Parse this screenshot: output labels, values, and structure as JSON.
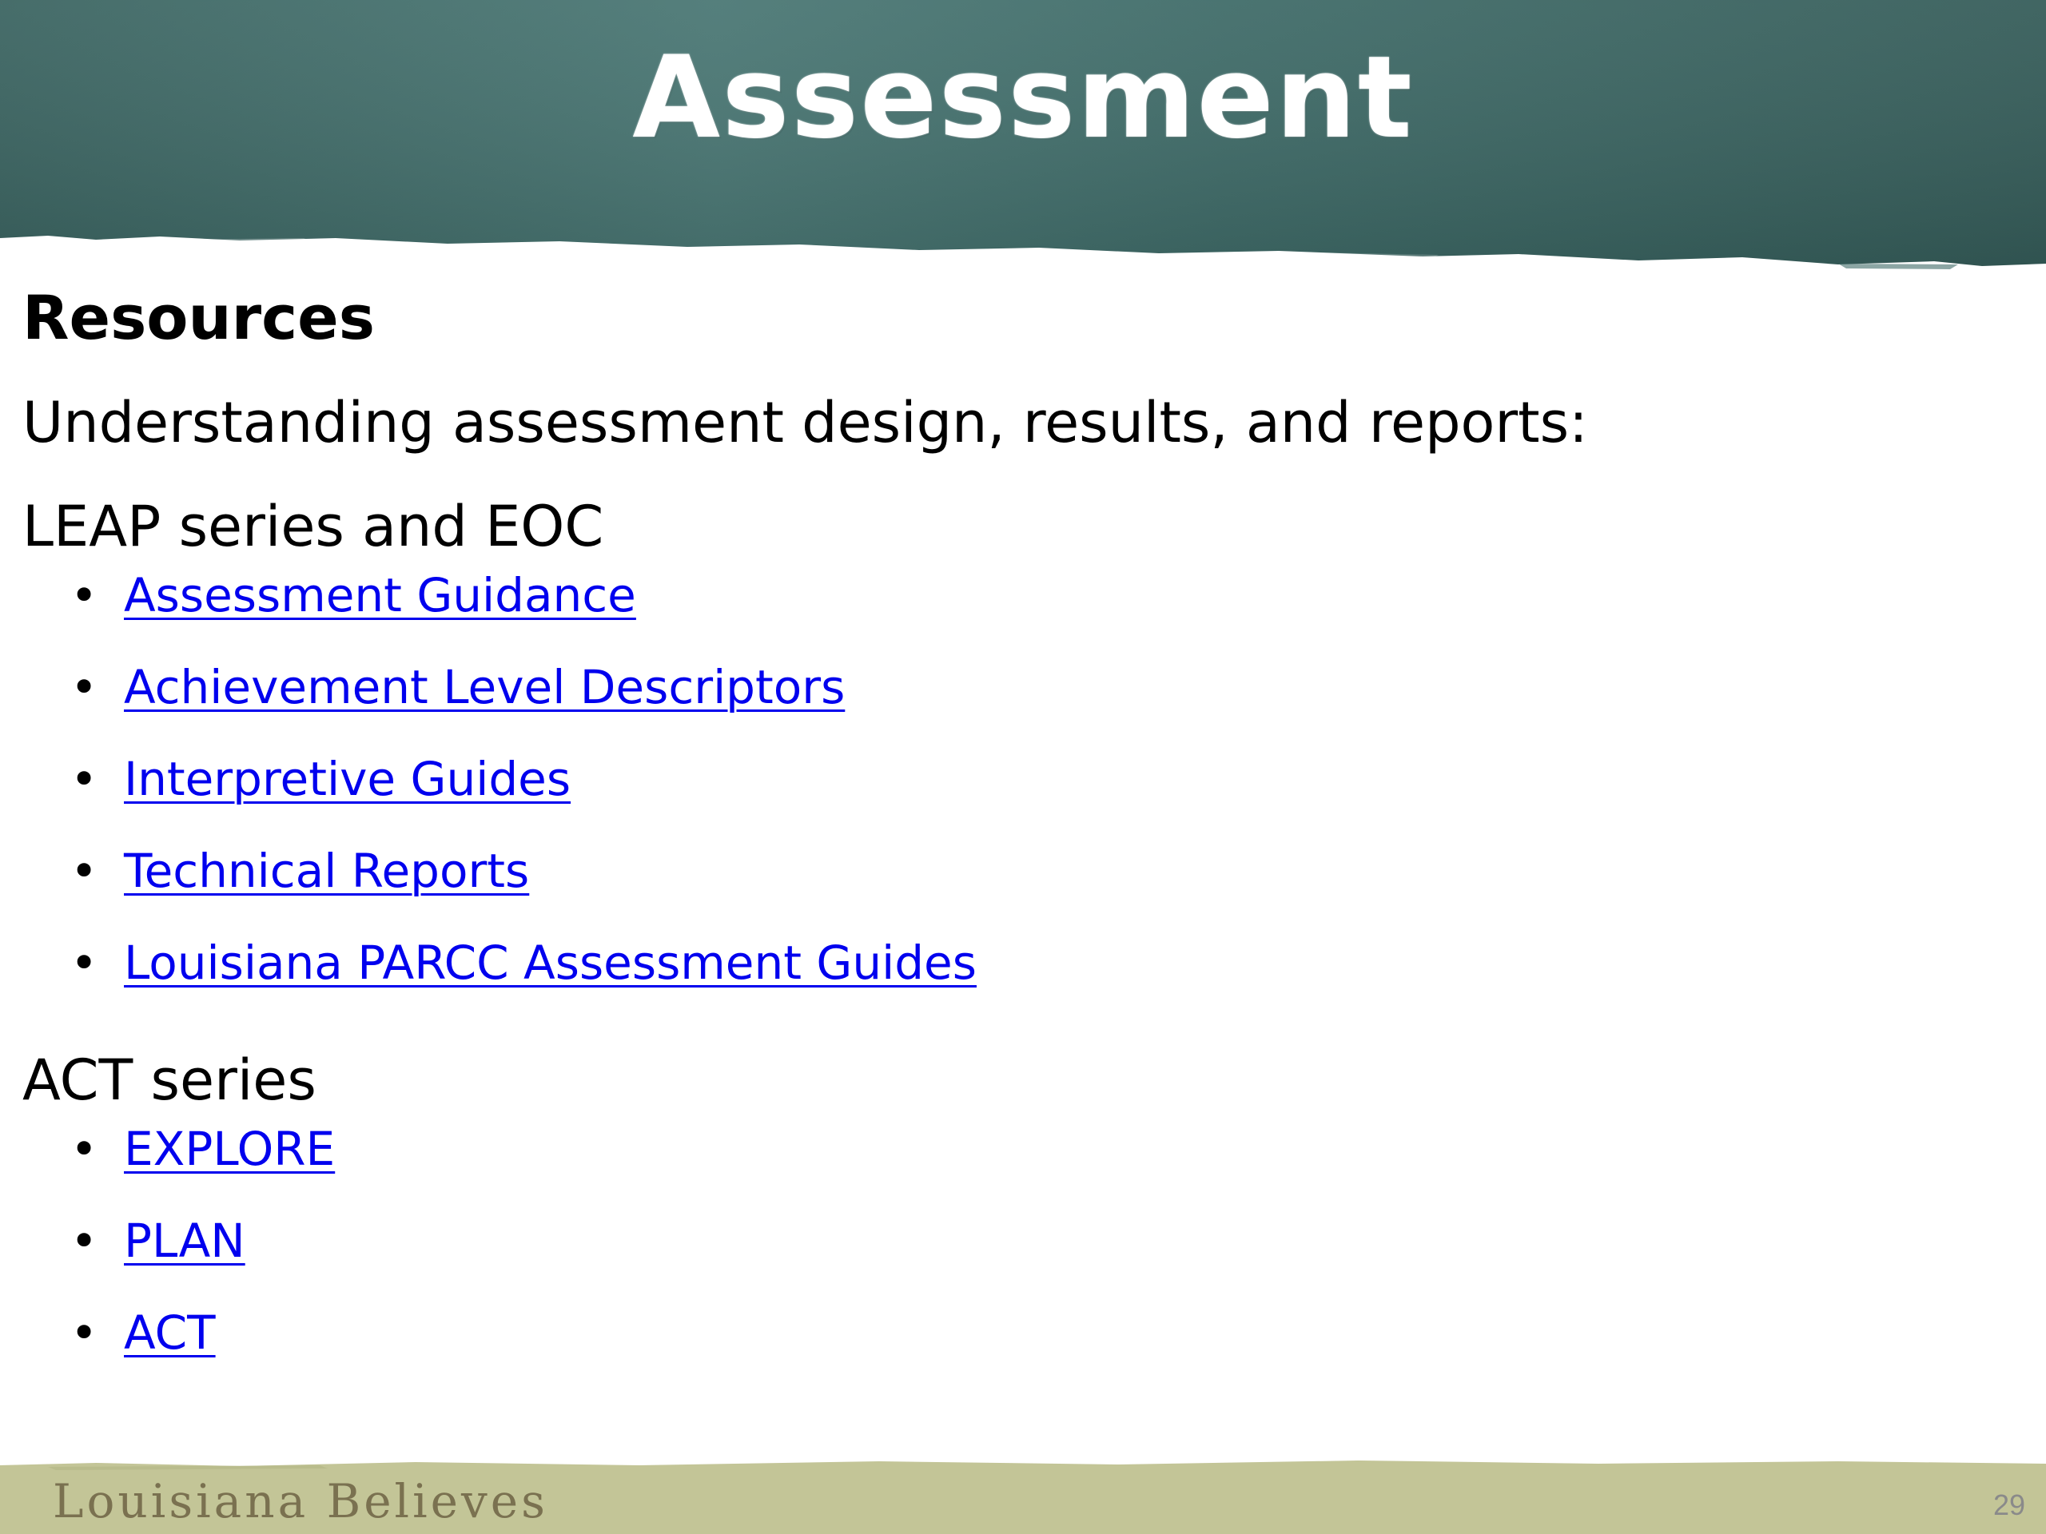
{
  "slide": {
    "title": "Assessment",
    "heading": "Resources",
    "intro": "Understanding assessment design, results, and reports:",
    "sections": [
      {
        "label": "LEAP series and EOC",
        "links": [
          "Assessment Guidance",
          "Achievement Level Descriptors",
          "Interpretive Guides",
          "Technical Reports",
          "Louisiana PARCC Assessment Guides"
        ]
      },
      {
        "label": "ACT series",
        "links": [
          "EXPLORE",
          "PLAN",
          "ACT"
        ]
      }
    ]
  },
  "footer": {
    "brand": "Louisiana Believes",
    "page_number": "29"
  },
  "colors": {
    "chalkboard": "#3f6b68",
    "link": "#0000ee",
    "footer_band": "#c3c597",
    "footer_text": "#7a7150"
  }
}
